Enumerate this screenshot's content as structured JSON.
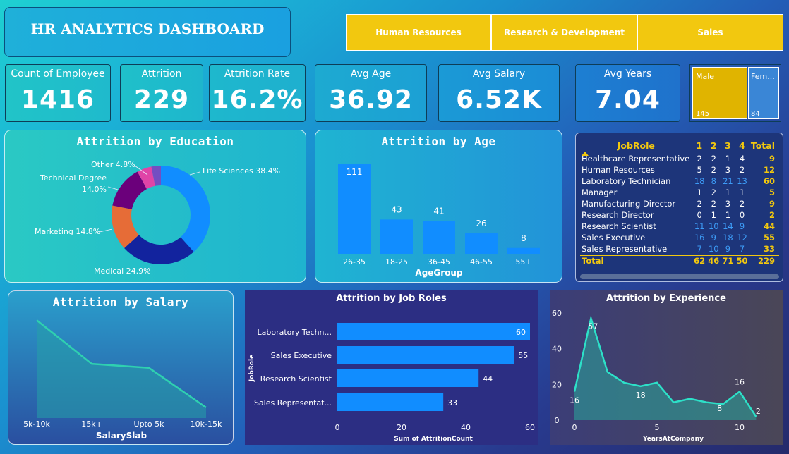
{
  "header": {
    "title": "HR ANALYTICS DASHBOARD"
  },
  "slicer": {
    "items": [
      "Human Resources",
      "Research & Development",
      "Sales"
    ]
  },
  "kpis": [
    {
      "label": "Count of Employee",
      "value": "1416"
    },
    {
      "label": "Attrition",
      "value": "229"
    },
    {
      "label": "Attrition Rate",
      "value": "16.2%"
    },
    {
      "label": "Avg Age",
      "value": "36.92"
    },
    {
      "label": "Avg Salary",
      "value": "6.52K"
    },
    {
      "label": "Avg Years",
      "value": "7.04"
    }
  ],
  "gender": {
    "male_label": "Male",
    "male_value": "145",
    "female_label": "Fem...",
    "female_value": "84"
  },
  "titles": {
    "education": "Attrition by Education",
    "age": "Attrition by Age",
    "salary": "Attrition by Salary",
    "jobroles": "Attrition by Job Roles",
    "experience": "Attrition by Experience"
  },
  "colors": {
    "accent": "#118dff",
    "yellow": "#f2c80f",
    "teal": "#2de0c8"
  },
  "matrix": {
    "headers": [
      "JobRole",
      "1",
      "2",
      "3",
      "4",
      "Total"
    ],
    "rows": [
      {
        "role": "Healthcare Representative",
        "v": [
          "2",
          "2",
          "1",
          "4"
        ],
        "total": "9"
      },
      {
        "role": "Human Resources",
        "v": [
          "5",
          "2",
          "3",
          "2"
        ],
        "total": "12"
      },
      {
        "role": "Laboratory Technician",
        "v": [
          "18",
          "8",
          "21",
          "13"
        ],
        "total": "60"
      },
      {
        "role": "Manager",
        "v": [
          "1",
          "2",
          "1",
          "1"
        ],
        "total": "5"
      },
      {
        "role": "Manufacturing Director",
        "v": [
          "2",
          "2",
          "3",
          "2"
        ],
        "total": "9"
      },
      {
        "role": "Research Director",
        "v": [
          "0",
          "1",
          "1",
          "0"
        ],
        "total": "2"
      },
      {
        "role": "Research Scientist",
        "v": [
          "11",
          "10",
          "14",
          "9"
        ],
        "total": "44"
      },
      {
        "role": "Sales Executive",
        "v": [
          "16",
          "9",
          "18",
          "12"
        ],
        "total": "55"
      },
      {
        "role": "Sales Representative",
        "v": [
          "7",
          "10",
          "9",
          "7"
        ],
        "total": "33"
      }
    ],
    "total": {
      "label": "Total",
      "v": [
        "62",
        "46",
        "71",
        "50"
      ],
      "total": "229"
    }
  },
  "chart_data": [
    {
      "type": "pie",
      "title": "Attrition by Education",
      "categories": [
        "Life Sciences",
        "Medical",
        "Marketing",
        "Technical Degree",
        "Other"
      ],
      "values": [
        38.4,
        24.9,
        14.8,
        14.0,
        4.8
      ],
      "labels": [
        "Life Sciences 38.4%",
        "Medical 24.9%",
        "Marketing 14.8%",
        "Technical Degree 14.0%",
        "Other 4.8%"
      ],
      "colors": [
        "#118dff",
        "#12239e",
        "#e66c37",
        "#6b007b",
        "#e044a7",
        "#744ec2"
      ]
    },
    {
      "type": "bar",
      "title": "Attrition by Age",
      "xlabel": "AgeGroup",
      "categories": [
        "26-35",
        "18-25",
        "36-45",
        "46-55",
        "55+"
      ],
      "values": [
        111,
        43,
        41,
        26,
        8
      ]
    },
    {
      "type": "area",
      "title": "Attrition by Salary",
      "xlabel": "SalarySlab",
      "categories": [
        "5k-10k",
        "15k+",
        "Upto 5k",
        "10k-15k"
      ],
      "values": [
        74,
        41,
        38,
        8
      ]
    },
    {
      "type": "bar",
      "title": "Attrition by Job Roles",
      "xlabel": "Sum of AttritionCount",
      "ylabel": "JobRole",
      "categories": [
        "Laboratory Techn...",
        "Sales Executive",
        "Research Scientist",
        "Sales Representat..."
      ],
      "values": [
        60,
        55,
        44,
        33
      ],
      "xticks": [
        "0",
        "20",
        "40",
        "60"
      ],
      "xlim": [
        0,
        60
      ]
    },
    {
      "type": "area",
      "title": "Attrition by Experience",
      "xlabel": "YearsAtCompany",
      "x": [
        0,
        1,
        2,
        3,
        4,
        5,
        6,
        7,
        8,
        9,
        10,
        11
      ],
      "values": [
        16,
        57,
        27,
        21,
        19,
        21,
        10,
        12,
        10,
        9,
        16,
        2
      ],
      "labeled": [
        "16",
        "57",
        "18",
        "8",
        "16",
        "2"
      ],
      "xticks": [
        "0",
        "5",
        "10"
      ],
      "yticks": [
        "0",
        "20",
        "40",
        "60"
      ],
      "ylim": [
        0,
        60
      ]
    }
  ]
}
